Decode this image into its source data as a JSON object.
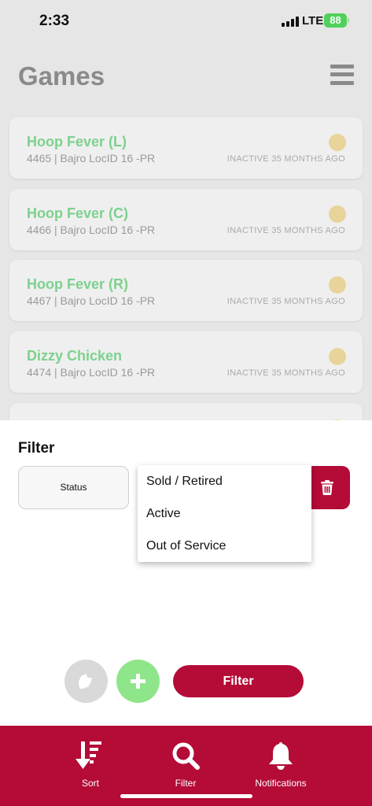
{
  "status_bar": {
    "time": "2:33",
    "network": "LTE",
    "battery": "88"
  },
  "header": {
    "title": "Games",
    "menu_icon": "hamburger-menu-icon"
  },
  "games": [
    {
      "name": "Hoop Fever (L)",
      "details": "4465 | Bajro LocID 16 -PR",
      "status": "INACTIVE 35 MONTHS AGO"
    },
    {
      "name": "Hoop Fever (C)",
      "details": "4466 | Bajro LocID 16 -PR",
      "status": "INACTIVE 35 MONTHS AGO"
    },
    {
      "name": "Hoop Fever (R)",
      "details": "4467 | Bajro LocID 16 -PR",
      "status": "INACTIVE 35 MONTHS AGO"
    },
    {
      "name": "Dizzy Chicken",
      "details": "4474 | Bajro LocID 16 -PR",
      "status": "INACTIVE 35 MONTHS AGO"
    }
  ],
  "filter_sheet": {
    "title": "Filter",
    "status_select_label": "Status",
    "dropdown_options": [
      "Sold / Retired",
      "Active",
      "Out of Service"
    ],
    "filter_button_label": "Filter"
  },
  "bottom_nav": [
    {
      "label": "Sort",
      "icon": "sort-icon"
    },
    {
      "label": "Filter",
      "icon": "search-icon"
    },
    {
      "label": "Notifications",
      "icon": "bell-icon"
    }
  ],
  "colors": {
    "brand": "#b40b37",
    "game_name": "#7dd18d",
    "status_dot": "#e8d49a",
    "add_button": "#8fe58a"
  }
}
